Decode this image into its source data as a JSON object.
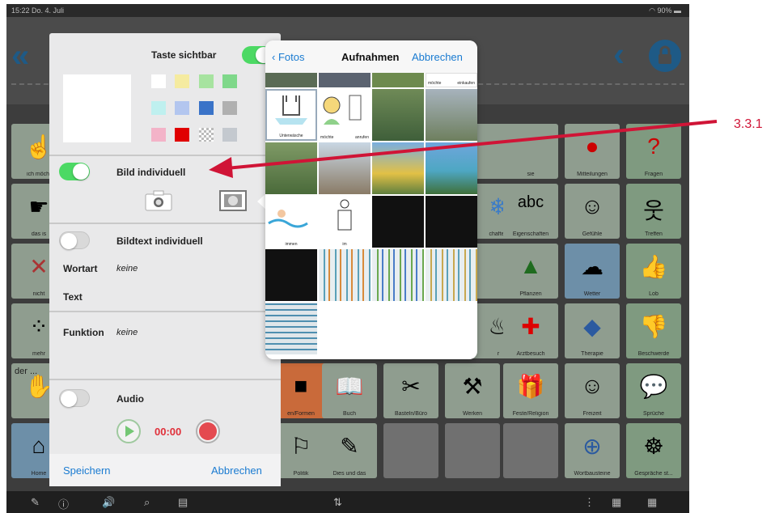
{
  "status_bar": {
    "time_date": "15:22  Do. 4. Juli",
    "battery": "90%"
  },
  "board_tiles": [
    {
      "label": "ich möcht"
    },
    {
      "label": "das is"
    },
    {
      "label": "nicht"
    },
    {
      "label": "mehr"
    },
    {
      "label": "der ... "
    },
    {
      "label": "Home"
    },
    {
      "label": "sie"
    },
    {
      "label": "Mitteilungen"
    },
    {
      "label": "Fragen"
    },
    {
      "label": "chaften"
    },
    {
      "label": "Eigenschaften"
    },
    {
      "label": "Gefühle"
    },
    {
      "label": "Treffen"
    },
    {
      "label": "Pflanzen"
    },
    {
      "label": "Wetter"
    },
    {
      "label": "Lob"
    },
    {
      "label": "r"
    },
    {
      "label": "Arztbesuch"
    },
    {
      "label": "Therapie"
    },
    {
      "label": "Beschwerde"
    },
    {
      "label": "en/Formen"
    },
    {
      "label": "Buch"
    },
    {
      "label": "Basteln/Büro"
    },
    {
      "label": "Werken"
    },
    {
      "label": "Feste/Religion"
    },
    {
      "label": "Freizeit"
    },
    {
      "label": "Sprüche"
    },
    {
      "label": "Politik"
    },
    {
      "label": "Dies und das"
    },
    {
      "label": "Wortbausteine"
    },
    {
      "label": "Gespräche st..."
    }
  ],
  "panel": {
    "button_visible_label": "Taste sichtbar",
    "image_individual_label": "Bild individuell",
    "image_text_individual_label": "Bildtext individuell",
    "word_type_label": "Wortart",
    "word_type_value": "keine",
    "text_label": "Text",
    "function_label": "Funktion",
    "function_value": "keine",
    "audio_label": "Audio",
    "audio_time": "00:00",
    "save_label": "Speichern",
    "cancel_label": "Abbrechen",
    "colors": [
      "#ffffff",
      "#f5eba0",
      "#a7e3a0",
      "#7fd88a",
      "#bff0ef",
      "#b3c6ef",
      "#3a73c8",
      "#b0b0b0",
      "#f3b3c8",
      "#e00000",
      "checker",
      "#c4c9cf"
    ]
  },
  "picker": {
    "back_label": "Fotos",
    "title": "Aufnahmen",
    "cancel_label": "Abbrechen",
    "captions": {
      "c1": "möchte",
      "c2": "einkaufen",
      "c3": "Unterwäsche",
      "c4": "möchte",
      "c5": "anrufen",
      "c6": "immen",
      "c7": "im",
      "c8": "im"
    }
  },
  "annotation": {
    "label": "3.3.1",
    "color": "#d01436"
  }
}
